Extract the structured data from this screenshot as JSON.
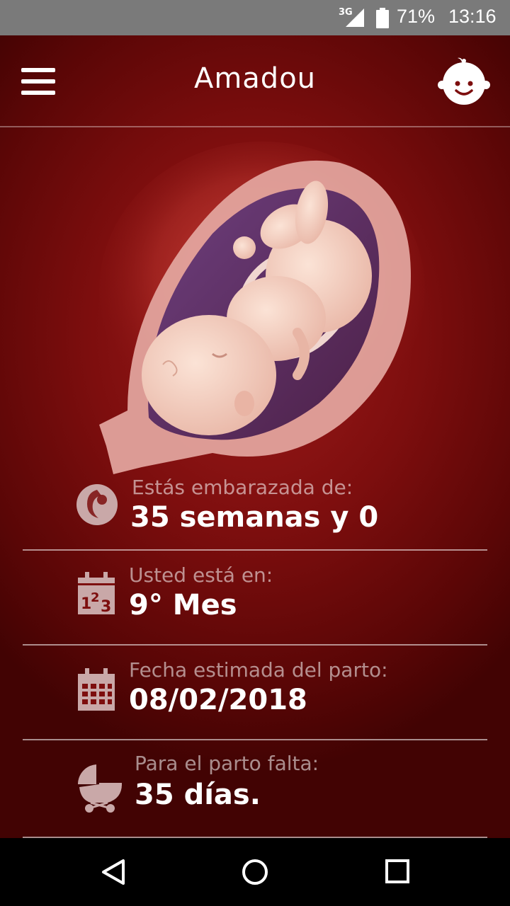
{
  "status_bar": {
    "network": "3G",
    "battery_percent": "71%",
    "time": "13:16"
  },
  "toolbar": {
    "title": "Amadou",
    "menu_icon": "hamburger-menu-icon",
    "profile_icon": "baby-face-icon"
  },
  "illustration": {
    "icon": "fetus-in-womb-illustration"
  },
  "info": [
    {
      "icon": "fetus-circle-icon",
      "label": "Estás embarazada de:",
      "value": "35 semanas y 0"
    },
    {
      "icon": "calendar-123-icon",
      "label": "Usted está en:",
      "value": "9° Mes"
    },
    {
      "icon": "calendar-grid-icon",
      "label": "Fecha estimada del parto:",
      "value": "08/02/2018"
    },
    {
      "icon": "baby-stroller-icon",
      "label": "Para el parto falta:",
      "value": "35 días."
    }
  ],
  "nav": {
    "back_icon": "back-triangle-icon",
    "home_icon": "home-circle-icon",
    "recents_icon": "recents-square-icon"
  },
  "colors": {
    "background": "#7d0e0e",
    "status_bar": "#7a7a7a",
    "icon_muted": "#c9a8a8"
  }
}
